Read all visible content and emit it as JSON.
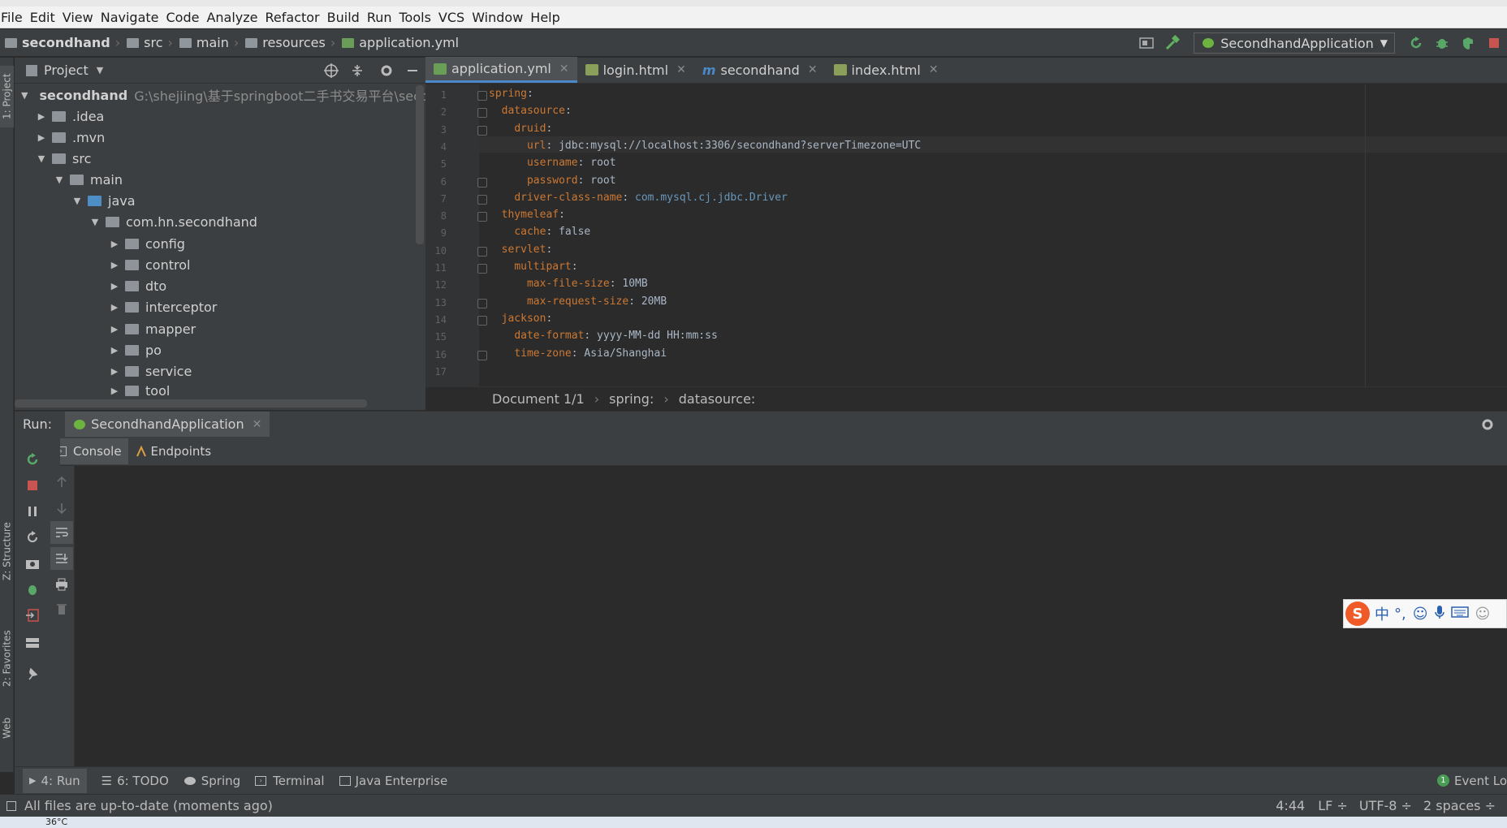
{
  "menu": [
    "File",
    "Edit",
    "View",
    "Navigate",
    "Code",
    "Analyze",
    "Refactor",
    "Build",
    "Run",
    "Tools",
    "VCS",
    "Window",
    "Help"
  ],
  "breadcrumb": [
    "secondhand",
    "src",
    "main",
    "resources",
    "application.yml"
  ],
  "run_config": "SecondhandApplication",
  "left_strip": {
    "project": "1: Project",
    "structure": "Z: Structure",
    "favorites": "2: Favorites",
    "web": "Web"
  },
  "project_panel": {
    "title": "Project",
    "root_name": "secondhand",
    "root_path": "G:\\shejiing\\基于springboot二手书交易平台\\seconc",
    "items": [
      ".idea",
      ".mvn",
      "src",
      "main",
      "java",
      "com.hn.secondhand",
      "config",
      "control",
      "dto",
      "interceptor",
      "mapper",
      "po",
      "service",
      "tool"
    ]
  },
  "tabs": [
    {
      "label": "application.yml"
    },
    {
      "label": "login.html"
    },
    {
      "label": "secondhand"
    },
    {
      "label": "index.html"
    }
  ],
  "code_lines": [
    {
      "n": "1",
      "indent": "",
      "key": "spring",
      "sep": ":",
      "val": ""
    },
    {
      "n": "2",
      "indent": "  ",
      "key": "datasource",
      "sep": ":",
      "val": ""
    },
    {
      "n": "3",
      "indent": "    ",
      "key": "druid",
      "sep": ":",
      "val": ""
    },
    {
      "n": "4",
      "indent": "      ",
      "key": "url",
      "sep": ":",
      "val": " jdbc:mysql://localhost:3306/secondhand?serverTimezone=UTC"
    },
    {
      "n": "5",
      "indent": "      ",
      "key": "username",
      "sep": ":",
      "val": " root"
    },
    {
      "n": "6",
      "indent": "      ",
      "key": "password",
      "sep": ":",
      "val": " root"
    },
    {
      "n": "7",
      "indent": "    ",
      "key": "driver-class-name",
      "sep": ":",
      "val": " com.mysql.cj.jdbc.Driver"
    },
    {
      "n": "8",
      "indent": "  ",
      "key": "thymeleaf",
      "sep": ":",
      "val": ""
    },
    {
      "n": "9",
      "indent": "    ",
      "key": "cache",
      "sep": ":",
      "val": " false"
    },
    {
      "n": "10",
      "indent": "  ",
      "key": "servlet",
      "sep": ":",
      "val": ""
    },
    {
      "n": "11",
      "indent": "    ",
      "key": "multipart",
      "sep": ":",
      "val": ""
    },
    {
      "n": "12",
      "indent": "      ",
      "key": "max-file-size",
      "sep": ":",
      "val": " 10MB"
    },
    {
      "n": "13",
      "indent": "      ",
      "key": "max-request-size",
      "sep": ":",
      "val": " 20MB"
    },
    {
      "n": "14",
      "indent": "  ",
      "key": "jackson",
      "sep": ":",
      "val": ""
    },
    {
      "n": "15",
      "indent": "    ",
      "key": "date-format",
      "sep": ":",
      "val": " yyyy-MM-dd HH:mm:ss"
    },
    {
      "n": "16",
      "indent": "    ",
      "key": "time-zone",
      "sep": ":",
      "val": " Asia/Shanghai"
    },
    {
      "n": "17",
      "indent": "",
      "key": "",
      "sep": "",
      "val": ""
    }
  ],
  "doc_breadcrumb": {
    "doc": "Document 1/1",
    "a": "spring:",
    "b": "datasource:"
  },
  "run_panel": {
    "label": "Run:",
    "config": "SecondhandApplication",
    "console": "Console",
    "endpoints": "Endpoints"
  },
  "bottom_tools": {
    "run": "4: Run",
    "todo": "6: TODO",
    "spring": "Spring",
    "terminal": "Terminal",
    "javaee": "Java Enterprise",
    "event": "Event Lo",
    "event_count": "1"
  },
  "status": {
    "message": "All files are up-to-date (moments ago)",
    "pos": "4:44",
    "lf": "LF ÷",
    "enc": "UTF-8 ÷",
    "indent": "2 spaces ÷"
  },
  "ime": {
    "zh": "中",
    "punct": "°,"
  },
  "taskbar": {
    "temp": "36°C"
  }
}
